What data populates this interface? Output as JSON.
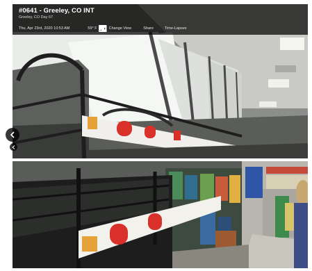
{
  "camera": {
    "title": "#0641 - Greeley, CO INT",
    "subtitle": "Greeley, CO   Day 67"
  },
  "meta": {
    "timestamp": "Thu, Apr 23rd, 2020 10:53 AM",
    "temperature": "59° F",
    "change_view": "Change View",
    "share": "Share",
    "timelapse": "Time-Lapses"
  },
  "icons": {
    "calendar": "calendar-icon",
    "thermometer": "thermometer-icon",
    "change_view": "view-icon",
    "share": "share-icon",
    "timelapse": "timelapse-icon",
    "prev": "chevron-left-icon"
  },
  "colors": {
    "overlay": "#000000",
    "text": "#ffffff",
    "price_tag": "#d9302a"
  }
}
